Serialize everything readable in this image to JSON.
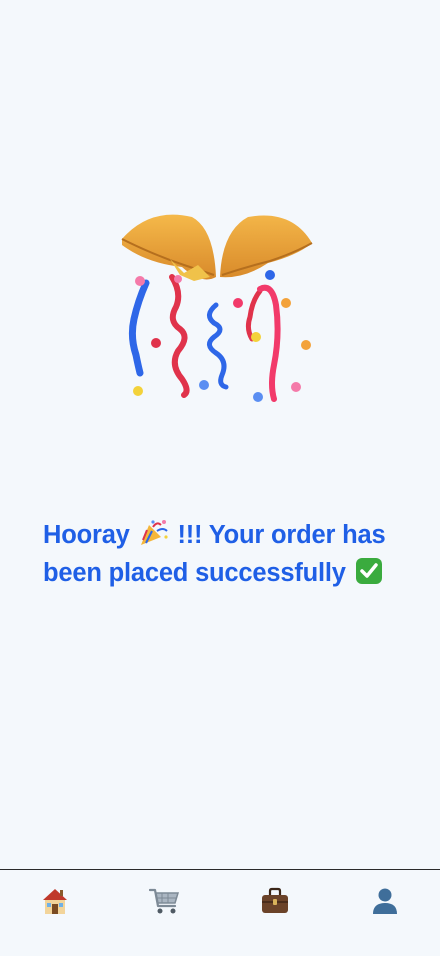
{
  "screen": {
    "illustration_icon": "confetti-ball-icon",
    "message": {
      "line1_text": "Hooray",
      "line1_emoji": "party-popper-icon",
      "line1_rest": "!!! Your order has",
      "line2_text": "been placed successfully",
      "line2_emoji": "check-mark-button-icon"
    }
  },
  "tabbar": {
    "items": [
      {
        "icon": "home-icon"
      },
      {
        "icon": "cart-icon"
      },
      {
        "icon": "briefcase-icon"
      },
      {
        "icon": "profile-icon"
      }
    ]
  },
  "colors": {
    "background": "#f4f8fc",
    "accent_text": "#1f5fe6",
    "divider": "#2a2a2a"
  }
}
